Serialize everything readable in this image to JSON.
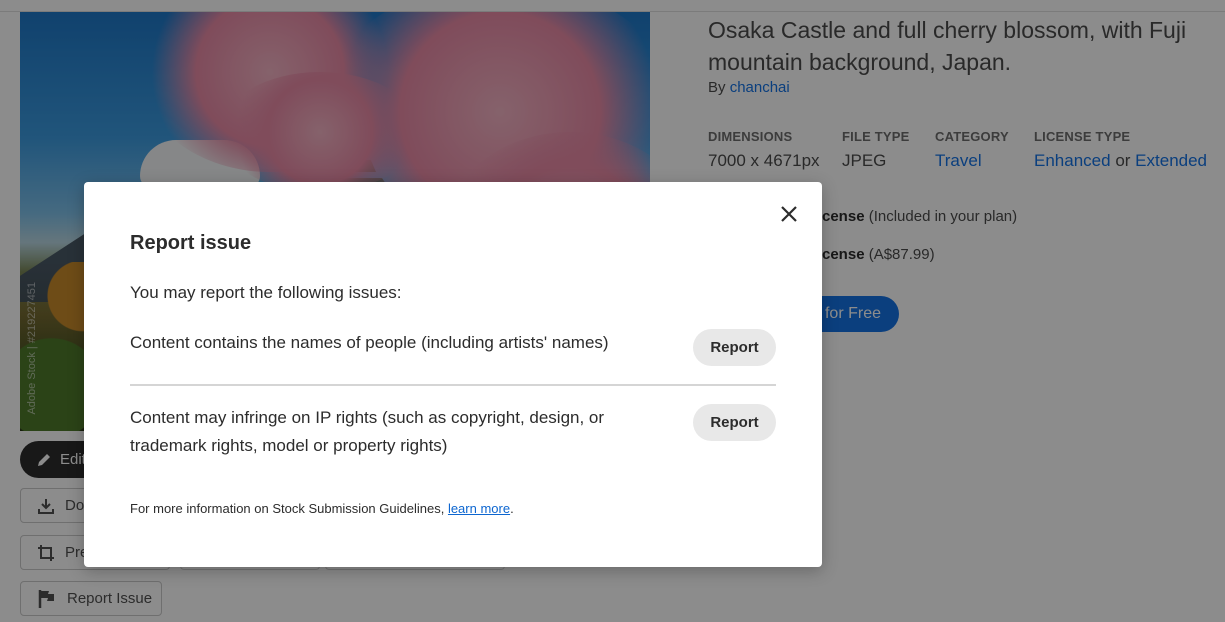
{
  "asset": {
    "title": "Osaka Castle and full cherry blossom, with Fuji mountain background, Japan.",
    "by_label": "By",
    "author": "chanchai",
    "watermark": "Adobe Stock | #219227451"
  },
  "meta": {
    "dimensions_label": "DIMENSIONS",
    "dimensions_value": "7000 x 4671px",
    "filetype_label": "FILE TYPE",
    "filetype_value": "JPEG",
    "category_label": "CATEGORY",
    "category_value": "Travel",
    "license_label": "LICENSE TYPE",
    "license_enhanced": "Enhanced",
    "license_or": "or",
    "license_extended": "Extended"
  },
  "licenses": {
    "standard_partial": "cense",
    "standard_note": "(Included in your plan)",
    "extended_partial": "cense",
    "extended_note": "(A$87.99)"
  },
  "cta": {
    "label_partial": "l for Free"
  },
  "left_actions": {
    "edit_label": "Edit",
    "download_label": "Dov",
    "preview_label": "Pre",
    "report_issue_label": "Report Issue"
  },
  "modal": {
    "title": "Report issue",
    "intro": "You may report the following issues:",
    "issues": [
      {
        "text": "Content contains the names of people (including artists' names)",
        "button": "Report"
      },
      {
        "text": "Content may infringe on IP rights (such as copyright, design, or trademark rights, model or property rights)",
        "button": "Report"
      }
    ],
    "footer_text": "For more information on Stock Submission Guidelines,",
    "footer_link": "learn more",
    "footer_end": "."
  },
  "colors": {
    "link": "#1473e6",
    "cta": "#1473e6",
    "overlay": "rgba(0,0,0,0.45)"
  }
}
